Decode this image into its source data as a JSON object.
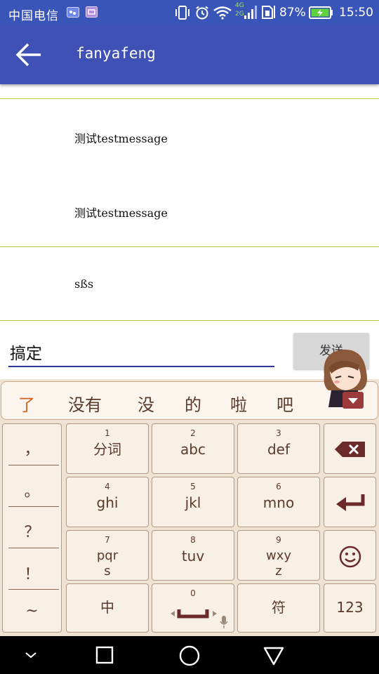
{
  "status_bar": {
    "carrier": "中国电信",
    "network_small_top": "4G",
    "network_small_bottom": "2G",
    "battery_percent": "87%",
    "time": "15:50",
    "icons": [
      "weather-icon",
      "app-notification-icon",
      "vibrate-icon",
      "alarm-icon",
      "wifi-icon",
      "signal-icon",
      "sim-icon",
      "battery-charging-icon"
    ]
  },
  "app_bar": {
    "title": "fanyafeng",
    "back_icon": "arrow-back-icon"
  },
  "messages": [
    {
      "text": "测试testmessage"
    },
    {
      "text": "测试testmessage"
    },
    {
      "text": "sßs"
    }
  ],
  "composer": {
    "input_value": "搞定",
    "send_label": "发送"
  },
  "keyboard": {
    "candidates": [
      "了",
      "没有",
      "没",
      "的",
      "啦",
      "吧"
    ],
    "punctuation": [
      "，",
      "。",
      "？",
      "！",
      "~"
    ],
    "keys": [
      {
        "num": "1",
        "label": "分词"
      },
      {
        "num": "2",
        "label": "abc"
      },
      {
        "num": "3",
        "label": "def"
      },
      {
        "num": "4",
        "label": "ghi"
      },
      {
        "num": "5",
        "label": "jkl"
      },
      {
        "num": "6",
        "label": "mno"
      },
      {
        "num": "7",
        "label": "pqr",
        "label2": "s"
      },
      {
        "num": "8",
        "label": "tuv"
      },
      {
        "num": "9",
        "label": "wxy",
        "label2": "z"
      }
    ],
    "bottom_row": {
      "lang_label": "中",
      "space_num": "0",
      "symbol_label": "符",
      "number_label": "123"
    },
    "side_icons": [
      "backspace-icon",
      "enter-icon",
      "emoji-icon"
    ]
  },
  "colors": {
    "status_bar": "#3a55b8",
    "app_bar": "#3f51b5",
    "divider": "#b6c94a",
    "keyboard_bg": "#efe3d3",
    "candidate_highlight": "#d4621c"
  }
}
